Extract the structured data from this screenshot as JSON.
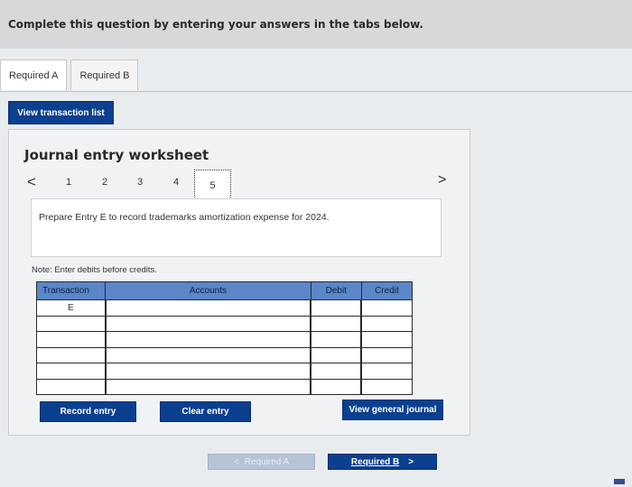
{
  "header": {
    "instruction": "Complete this question by entering your answers in the tabs below."
  },
  "tabs": [
    {
      "label": "Required A",
      "active": true
    },
    {
      "label": "Required B",
      "active": false
    }
  ],
  "view_transaction_list": "View transaction list",
  "worksheet": {
    "title": "Journal entry worksheet",
    "pager": {
      "prev": "<",
      "next": ">",
      "pages": [
        "1",
        "2",
        "3",
        "4",
        "5"
      ],
      "current": "5"
    },
    "prompt": "Prepare Entry E to record trademarks amortization expense for 2024.",
    "note": "Note: Enter debits before credits.",
    "table": {
      "headers": {
        "transaction": "Transaction",
        "accounts": "Accounts",
        "debit": "Debit",
        "credit": "Credit"
      },
      "rows": [
        {
          "transaction": "E",
          "account": "",
          "debit": "",
          "credit": ""
        },
        {
          "transaction": "",
          "account": "",
          "debit": "",
          "credit": ""
        },
        {
          "transaction": "",
          "account": "",
          "debit": "",
          "credit": ""
        },
        {
          "transaction": "",
          "account": "",
          "debit": "",
          "credit": ""
        },
        {
          "transaction": "",
          "account": "",
          "debit": "",
          "credit": ""
        },
        {
          "transaction": "",
          "account": "",
          "debit": "",
          "credit": ""
        }
      ]
    },
    "buttons": {
      "record_entry": "Record entry",
      "clear_entry": "Clear entry",
      "view_general_journal": "View general journal"
    }
  },
  "navigation": {
    "prev_label": "Required A",
    "next_label": "Required B"
  },
  "colors": {
    "primary": "#0b3f8f",
    "table_header": "#5b86c8"
  }
}
